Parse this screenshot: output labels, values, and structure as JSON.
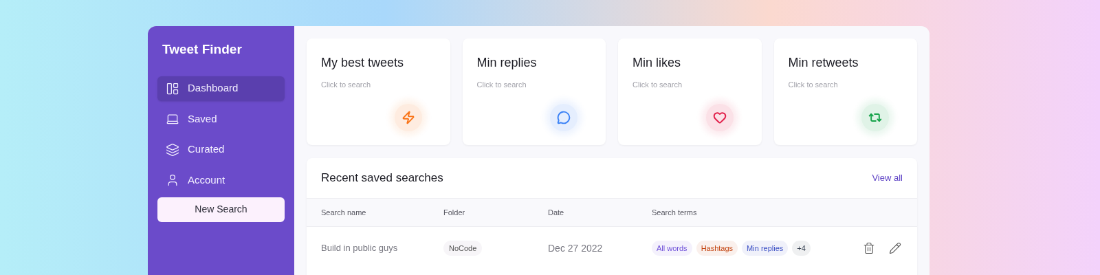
{
  "sidebar": {
    "title": "Tweet Finder",
    "items": [
      {
        "label": "Dashboard",
        "kind": "dashboard",
        "selected": true
      },
      {
        "label": "Saved",
        "kind": "saved",
        "selected": false
      },
      {
        "label": "Curated",
        "kind": "curated",
        "selected": false
      },
      {
        "label": "Account",
        "kind": "account",
        "selected": false
      }
    ],
    "button": "New Search"
  },
  "cards": [
    {
      "title": "My best tweets",
      "subtitle": "Click to search",
      "kind": "bolt",
      "color": "#f97316"
    },
    {
      "title": "Min replies",
      "subtitle": "Click to search",
      "kind": "chat",
      "color": "#3b82f6"
    },
    {
      "title": "Min likes",
      "subtitle": "Click to search",
      "kind": "heart",
      "color": "#e11d48"
    },
    {
      "title": "Min retweets",
      "subtitle": "Click to search",
      "kind": "repeat",
      "color": "#16a34a"
    }
  ],
  "recent": {
    "title": "Recent saved searches",
    "link": "View all",
    "columns": [
      "Search name",
      "Folder",
      "Date",
      "Search terms"
    ],
    "rows": [
      {
        "name": "Build in public guys",
        "folder": "NoCode",
        "date": "Dec 27 2022",
        "terms": [
          {
            "label": "All words",
            "color": "#6d4fd8"
          },
          {
            "label": "Hashtags",
            "color": "#c2410c"
          },
          {
            "label": "Min replies",
            "color": "#3b4fc4"
          },
          {
            "label": "+4",
            "color": "#374151"
          }
        ]
      }
    ]
  }
}
